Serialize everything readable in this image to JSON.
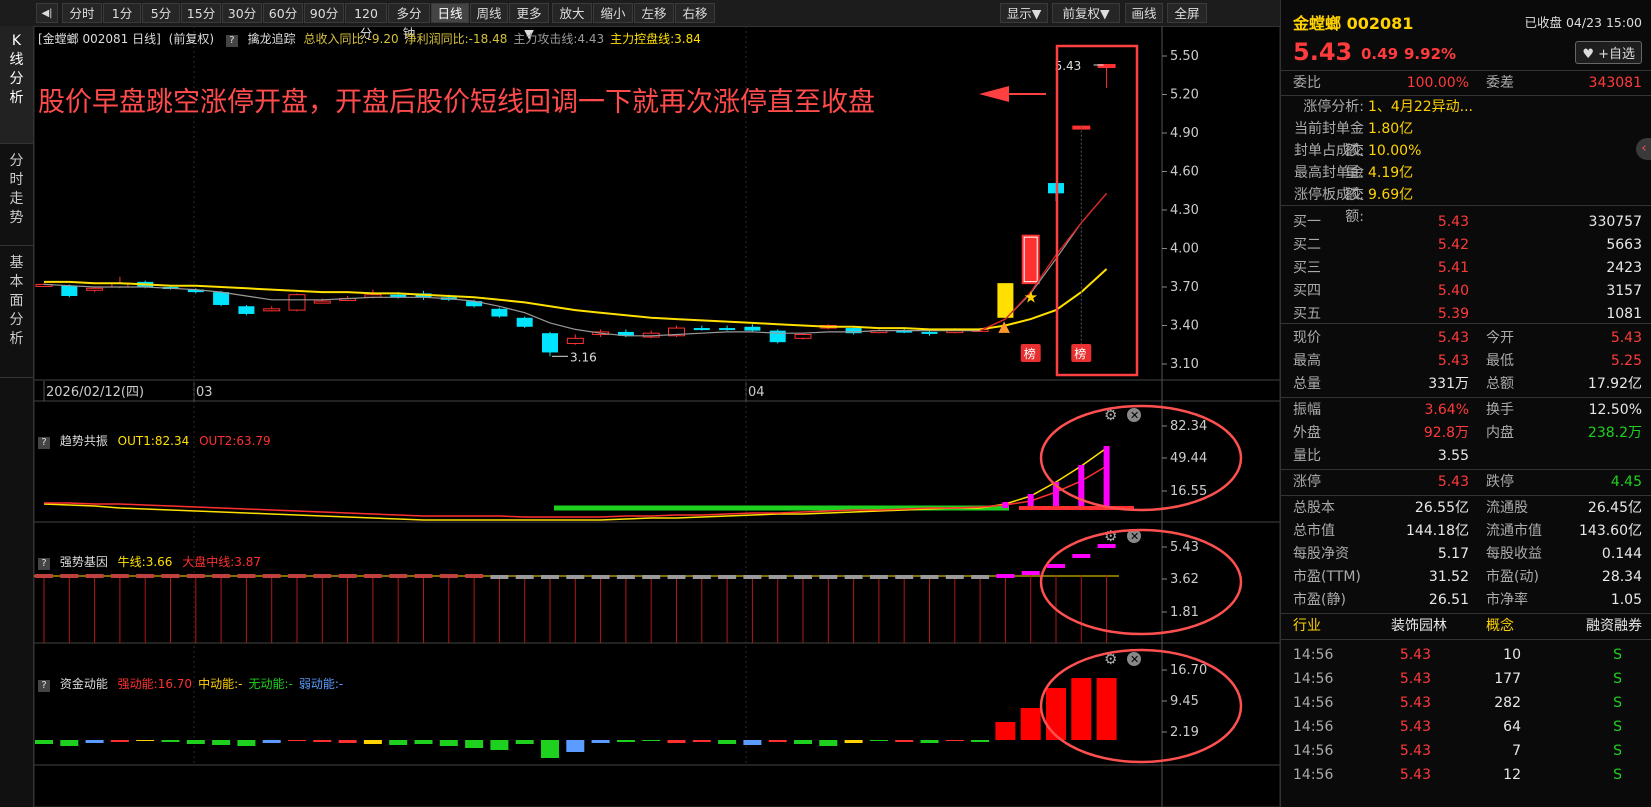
{
  "toolbar": {
    "collapse_glyph": "◀|",
    "periods": [
      "分时",
      "1分",
      "5分",
      "15分",
      "30分",
      "60分",
      "90分",
      "120分",
      "多分钟",
      "日线",
      "周线",
      "更多▼",
      "放大",
      "缩小",
      "左移",
      "右移"
    ],
    "active_period": "日线",
    "right_buttons": [
      "显示▼",
      "前复权▼",
      "画线",
      "全屏"
    ]
  },
  "left_tabs": [
    {
      "label": "K线分析",
      "active": true
    },
    {
      "label": "分时走势",
      "active": false
    },
    {
      "label": "基本面分析",
      "active": false
    }
  ],
  "main_chart": {
    "header_stock": "[金螳螂 002081 日线]",
    "header_adj": "(前复权)",
    "indicator_name": "擒龙追踪",
    "indicator_items": [
      {
        "text": "总收入同比:-9.20",
        "color": "#d6c23a"
      },
      {
        "text": "净利润同比:-18.48",
        "color": "#d6c23a"
      },
      {
        "text": "主力攻击线:4.43",
        "color": "#9a9a9a"
      },
      {
        "text": "主力控盘线:3.84",
        "color": "#ffe000"
      }
    ],
    "annotation": "股价早盘跳空涨停开盘，开盘后股价短线回调一下就再次涨停直至收盘",
    "y_ticks": [
      "5.50",
      "5.20",
      "4.90",
      "4.60",
      "4.30",
      "4.00",
      "3.70",
      "3.40",
      "3.10"
    ],
    "date_labels": [
      "2026/02/12(四)",
      "03",
      "04"
    ],
    "high_label": "5.43",
    "low_label": "3.16",
    "badge_text": "榜"
  },
  "chart_data": {
    "type": "candlestick",
    "ylim": [
      3.1,
      5.5
    ],
    "candles": [
      {
        "o": 3.71,
        "c": 3.72,
        "h": 3.73,
        "l": 3.7
      },
      {
        "o": 3.71,
        "c": 3.63,
        "h": 3.72,
        "l": 3.62
      },
      {
        "o": 3.68,
        "c": 3.69,
        "h": 3.7,
        "l": 3.66
      },
      {
        "o": 3.7,
        "c": 3.73,
        "h": 3.78,
        "l": 3.69
      },
      {
        "o": 3.74,
        "c": 3.7,
        "h": 3.75,
        "l": 3.69
      },
      {
        "o": 3.7,
        "c": 3.69,
        "h": 3.71,
        "l": 3.68
      },
      {
        "o": 3.68,
        "c": 3.66,
        "h": 3.69,
        "l": 3.65
      },
      {
        "o": 3.66,
        "c": 3.56,
        "h": 3.67,
        "l": 3.55
      },
      {
        "o": 3.55,
        "c": 3.49,
        "h": 3.56,
        "l": 3.48
      },
      {
        "o": 3.52,
        "c": 3.53,
        "h": 3.55,
        "l": 3.51
      },
      {
        "o": 3.52,
        "c": 3.64,
        "h": 3.65,
        "l": 3.51
      },
      {
        "o": 3.59,
        "c": 3.59,
        "h": 3.61,
        "l": 3.58
      },
      {
        "o": 3.6,
        "c": 3.61,
        "h": 3.63,
        "l": 3.59
      },
      {
        "o": 3.62,
        "c": 3.64,
        "h": 3.68,
        "l": 3.61
      },
      {
        "o": 3.64,
        "c": 3.62,
        "h": 3.66,
        "l": 3.61
      },
      {
        "o": 3.65,
        "c": 3.62,
        "h": 3.67,
        "l": 3.6
      },
      {
        "o": 3.62,
        "c": 3.6,
        "h": 3.64,
        "l": 3.59
      },
      {
        "o": 3.59,
        "c": 3.55,
        "h": 3.6,
        "l": 3.54
      },
      {
        "o": 3.53,
        "c": 3.47,
        "h": 3.54,
        "l": 3.46
      },
      {
        "o": 3.46,
        "c": 3.39,
        "h": 3.47,
        "l": 3.38
      },
      {
        "o": 3.34,
        "c": 3.19,
        "h": 3.35,
        "l": 3.16
      },
      {
        "o": 3.26,
        "c": 3.3,
        "h": 3.33,
        "l": 3.25
      },
      {
        "o": 3.33,
        "c": 3.35,
        "h": 3.37,
        "l": 3.31
      },
      {
        "o": 3.35,
        "c": 3.32,
        "h": 3.37,
        "l": 3.31
      },
      {
        "o": 3.31,
        "c": 3.34,
        "h": 3.36,
        "l": 3.3
      },
      {
        "o": 3.32,
        "c": 3.38,
        "h": 3.4,
        "l": 3.31
      },
      {
        "o": 3.38,
        "c": 3.37,
        "h": 3.4,
        "l": 3.36
      },
      {
        "o": 3.38,
        "c": 3.37,
        "h": 3.4,
        "l": 3.36
      },
      {
        "o": 3.39,
        "c": 3.36,
        "h": 3.41,
        "l": 3.35
      },
      {
        "o": 3.36,
        "c": 3.27,
        "h": 3.37,
        "l": 3.26
      },
      {
        "o": 3.3,
        "c": 3.33,
        "h": 3.34,
        "l": 3.29
      },
      {
        "o": 3.38,
        "c": 3.4,
        "h": 3.41,
        "l": 3.37
      },
      {
        "o": 3.38,
        "c": 3.34,
        "h": 3.39,
        "l": 3.33
      },
      {
        "o": 3.35,
        "c": 3.36,
        "h": 3.37,
        "l": 3.34
      },
      {
        "o": 3.36,
        "c": 3.35,
        "h": 3.38,
        "l": 3.34
      },
      {
        "o": 3.35,
        "c": 3.34,
        "h": 3.37,
        "l": 3.32
      },
      {
        "o": 3.35,
        "c": 3.36,
        "h": 3.38,
        "l": 3.34
      },
      {
        "o": 3.36,
        "c": 3.37,
        "h": 3.38,
        "l": 3.35
      },
      {
        "o": 3.46,
        "c": 3.73,
        "h": 3.73,
        "l": 3.46
      },
      {
        "o": 3.73,
        "c": 4.1,
        "h": 4.1,
        "l": 3.73
      },
      {
        "o": 4.51,
        "c": 4.43,
        "h": 4.51,
        "l": 4.37
      },
      {
        "o": 4.95,
        "c": 4.95,
        "h": 4.95,
        "l": 4.95
      },
      {
        "o": 5.43,
        "c": 5.43,
        "h": 5.43,
        "l": 5.25
      }
    ],
    "ma_yellow": [
      3.74,
      3.74,
      3.73,
      3.73,
      3.72,
      3.71,
      3.71,
      3.7,
      3.69,
      3.68,
      3.67,
      3.66,
      3.66,
      3.65,
      3.65,
      3.64,
      3.63,
      3.62,
      3.6,
      3.58,
      3.55,
      3.52,
      3.5,
      3.48,
      3.46,
      3.45,
      3.44,
      3.43,
      3.42,
      3.41,
      3.4,
      3.39,
      3.39,
      3.38,
      3.38,
      3.37,
      3.37,
      3.37,
      3.4,
      3.45,
      3.52,
      3.66,
      3.84
    ],
    "ma_red": [
      3.72,
      3.71,
      3.7,
      3.7,
      3.7,
      3.69,
      3.68,
      3.66,
      3.63,
      3.6,
      3.6,
      3.6,
      3.61,
      3.62,
      3.62,
      3.62,
      3.61,
      3.59,
      3.55,
      3.5,
      3.42,
      3.37,
      3.34,
      3.32,
      3.32,
      3.33,
      3.34,
      3.35,
      3.35,
      3.34,
      3.34,
      3.35,
      3.35,
      3.36,
      3.36,
      3.36,
      3.36,
      3.36,
      3.45,
      3.65,
      3.92,
      4.2,
      4.43
    ]
  },
  "panel1": {
    "name": "趋势共振",
    "out1": "OUT1:82.34",
    "out2": "OUT2:63.79",
    "y_ticks": [
      "82.34",
      "49.44",
      "16.55"
    ]
  },
  "panel2": {
    "name": "强势基因",
    "line1": "牛线:3.66",
    "line2": "大盘中线:3.87",
    "y_ticks": [
      "5.43",
      "3.62",
      "1.81"
    ]
  },
  "panel3": {
    "name": "资金动能",
    "items": [
      {
        "text": "强动能:16.70",
        "color": "#ff3030"
      },
      {
        "text": "中动能:-",
        "color": "#ffd200"
      },
      {
        "text": "无动能:-",
        "color": "#1fd11f"
      },
      {
        "text": "弱动能:-",
        "color": "#5a9cff"
      }
    ],
    "y_ticks": [
      "16.70",
      "9.45",
      "2.19"
    ]
  },
  "quote": {
    "name": "金螳螂 002081",
    "status": "已收盘 04/23 15:00",
    "price": "5.43",
    "change": "0.49",
    "pct": "9.92%",
    "follow_btn": "♥ +自选",
    "weibi_label": "委比",
    "weibi": "100.00%",
    "weicha_label": "委差",
    "weicha": "343081",
    "limit_analysis": [
      {
        "k": "涨停分析:",
        "v": "1、4月22异动..."
      },
      {
        "k": "当前封单金额:",
        "v": "1.80亿"
      },
      {
        "k": "封单占成交量:",
        "v": "10.00%"
      },
      {
        "k": "最高封单金额:",
        "v": "4.19亿"
      },
      {
        "k": "涨停板成交额:",
        "v": "9.69亿"
      }
    ],
    "bids": [
      {
        "label": "买一",
        "price": "5.43",
        "vol": "330757"
      },
      {
        "label": "买二",
        "price": "5.42",
        "vol": "5663"
      },
      {
        "label": "买三",
        "price": "5.41",
        "vol": "2423"
      },
      {
        "label": "买四",
        "price": "5.40",
        "vol": "3157"
      },
      {
        "label": "买五",
        "price": "5.39",
        "vol": "1081"
      }
    ],
    "stats": [
      {
        "k1": "现价",
        "v1": "5.43",
        "c1": "red",
        "k2": "今开",
        "v2": "5.43",
        "c2": "red"
      },
      {
        "k1": "最高",
        "v1": "5.43",
        "c1": "red",
        "k2": "最低",
        "v2": "5.25",
        "c2": "red"
      },
      {
        "k1": "总量",
        "v1": "331万",
        "c1": "wht",
        "k2": "总额",
        "v2": "17.92亿",
        "c2": "wht"
      }
    ],
    "stats2": [
      {
        "k1": "振幅",
        "v1": "3.64%",
        "c1": "red",
        "k2": "换手",
        "v2": "12.50%",
        "c2": "wht"
      },
      {
        "k1": "外盘",
        "v1": "92.8万",
        "c1": "red",
        "k2": "内盘",
        "v2": "238.2万",
        "c2": "green"
      },
      {
        "k1": "量比",
        "v1": "3.55",
        "c1": "wht",
        "k2": "",
        "v2": "",
        "c2": "wht"
      }
    ],
    "stats3": [
      {
        "k1": "涨停",
        "v1": "5.43",
        "c1": "red",
        "k2": "跌停",
        "v2": "4.45",
        "c2": "green"
      }
    ],
    "stats4": [
      {
        "k1": "总股本",
        "v1": "26.55亿",
        "k2": "流通股",
        "v2": "26.45亿"
      },
      {
        "k1": "总市值",
        "v1": "144.18亿",
        "k2": "流通市值",
        "v2": "143.60亿"
      },
      {
        "k1": "每股净资",
        "v1": "5.17",
        "k2": "每股收益",
        "v2": "0.144"
      },
      {
        "k1": "市盈(TTM)",
        "v1": "31.52",
        "k2": "市盈(动)",
        "v2": "28.34"
      },
      {
        "k1": "市盈(静)",
        "v1": "26.51",
        "k2": "市净率",
        "v2": "1.05"
      }
    ],
    "industry_row": {
      "k": "行业",
      "v": "装饰园林",
      "k2": "概念",
      "v2": "融资融券"
    },
    "ticks": [
      {
        "t": "14:56",
        "p": "5.43",
        "v": "10",
        "s": "S"
      },
      {
        "t": "14:56",
        "p": "5.43",
        "v": "177",
        "s": "S"
      },
      {
        "t": "14:56",
        "p": "5.43",
        "v": "282",
        "s": "S"
      },
      {
        "t": "14:56",
        "p": "5.43",
        "v": "64",
        "s": "S"
      },
      {
        "t": "14:56",
        "p": "5.43",
        "v": "7",
        "s": "S"
      },
      {
        "t": "14:56",
        "p": "5.43",
        "v": "12",
        "s": "S"
      }
    ]
  },
  "colors": {
    "up": "#ff3030",
    "down": "#00e5ff",
    "yellow_line": "#ffe000",
    "red_line": "#e02020",
    "highlight_box": "#ff4040"
  }
}
